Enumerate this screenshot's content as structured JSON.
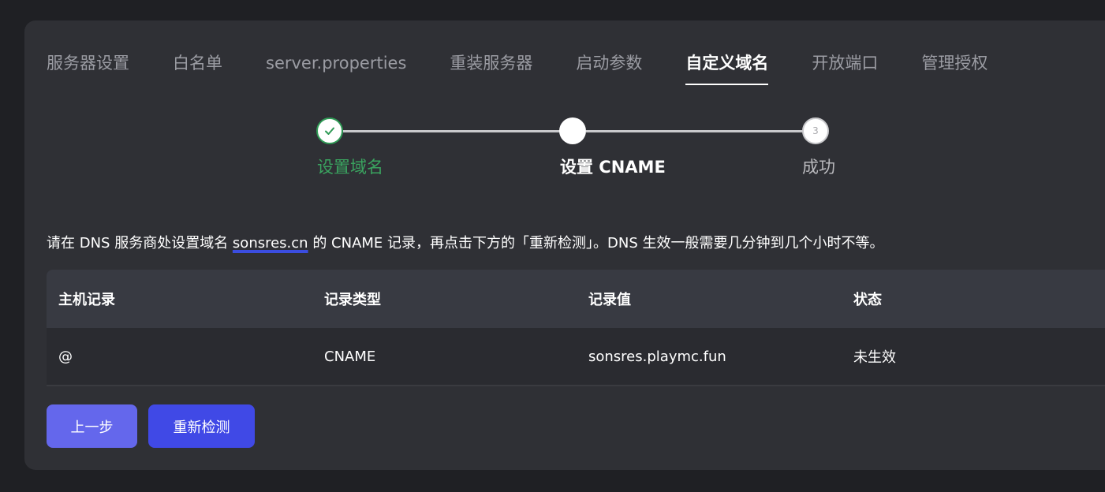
{
  "tabs": [
    {
      "label": "服务器设置"
    },
    {
      "label": "白名单"
    },
    {
      "label": "server.properties"
    },
    {
      "label": "重装服务器"
    },
    {
      "label": "启动参数"
    },
    {
      "label": "自定义域名",
      "active": true
    },
    {
      "label": "开放端口"
    },
    {
      "label": "管理授权"
    }
  ],
  "steps": [
    {
      "label": "设置域名",
      "state": "done",
      "icon": "check-icon"
    },
    {
      "label": "设置 CNAME",
      "state": "current"
    },
    {
      "label": "成功",
      "state": "pending",
      "number": "3"
    }
  ],
  "notice": {
    "prefix": "请在 DNS 服务商处设置域名 ",
    "domain": "sonsres.cn",
    "suffix": " 的 CNAME 记录，再点击下方的「重新检测」。DNS 生效一般需要几分钟到几个小时不等。"
  },
  "table": {
    "headers": [
      "主机记录",
      "记录类型",
      "记录值",
      "状态"
    ],
    "rows": [
      [
        "@",
        "CNAME",
        "sonsres.playmc.fun",
        "未生效"
      ]
    ]
  },
  "buttons": {
    "prev_label": "上一步",
    "recheck_label": "重新检测"
  },
  "colors": {
    "success": "#3aa35f",
    "primary": "#4049e6",
    "primary_light": "#6467ec"
  }
}
